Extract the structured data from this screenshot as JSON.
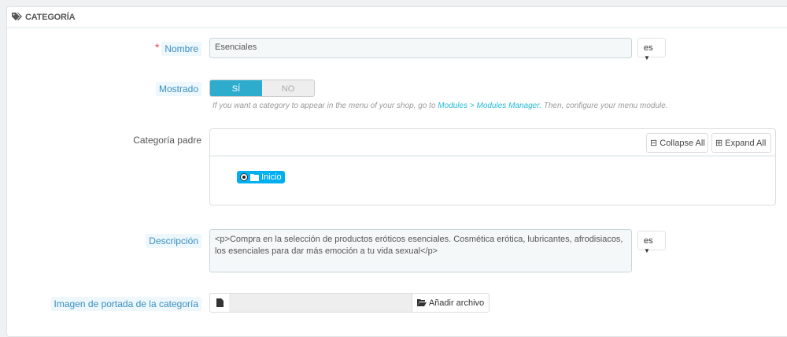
{
  "panel": {
    "title": "CATEGORÍA",
    "icon": "tags-icon"
  },
  "name_field": {
    "label": "Nombre",
    "required_mark": "*",
    "value": "Esenciales",
    "lang": "es"
  },
  "displayed": {
    "label": "Mostrado",
    "yes": "SÍ",
    "no": "NO",
    "selected": "SÍ",
    "help_before": "If you want a category to appear in the menu of your shop, go to",
    "help_link": "Modules > Modules Manager.",
    "help_after": "Then, configure your menu module."
  },
  "parent": {
    "label": "Categoría padre",
    "collapse": "Collapse All",
    "expand": "Expand All",
    "root": "Inicio"
  },
  "description": {
    "label": "Descripción",
    "value": "<p>Compra en la selección de productos eróticos esenciales. Cosmética erótica, lubricantes, afrodisiacos, los esenciales para dar más emoción a tu vida sexual</p>",
    "lang": "es"
  },
  "cover": {
    "label": "Imagen de portada de la categoría",
    "button": "Añadir archivo"
  },
  "colors": {
    "accent": "#25b9d7",
    "switch_on": "#2eacce",
    "badge": "#00aff0"
  }
}
